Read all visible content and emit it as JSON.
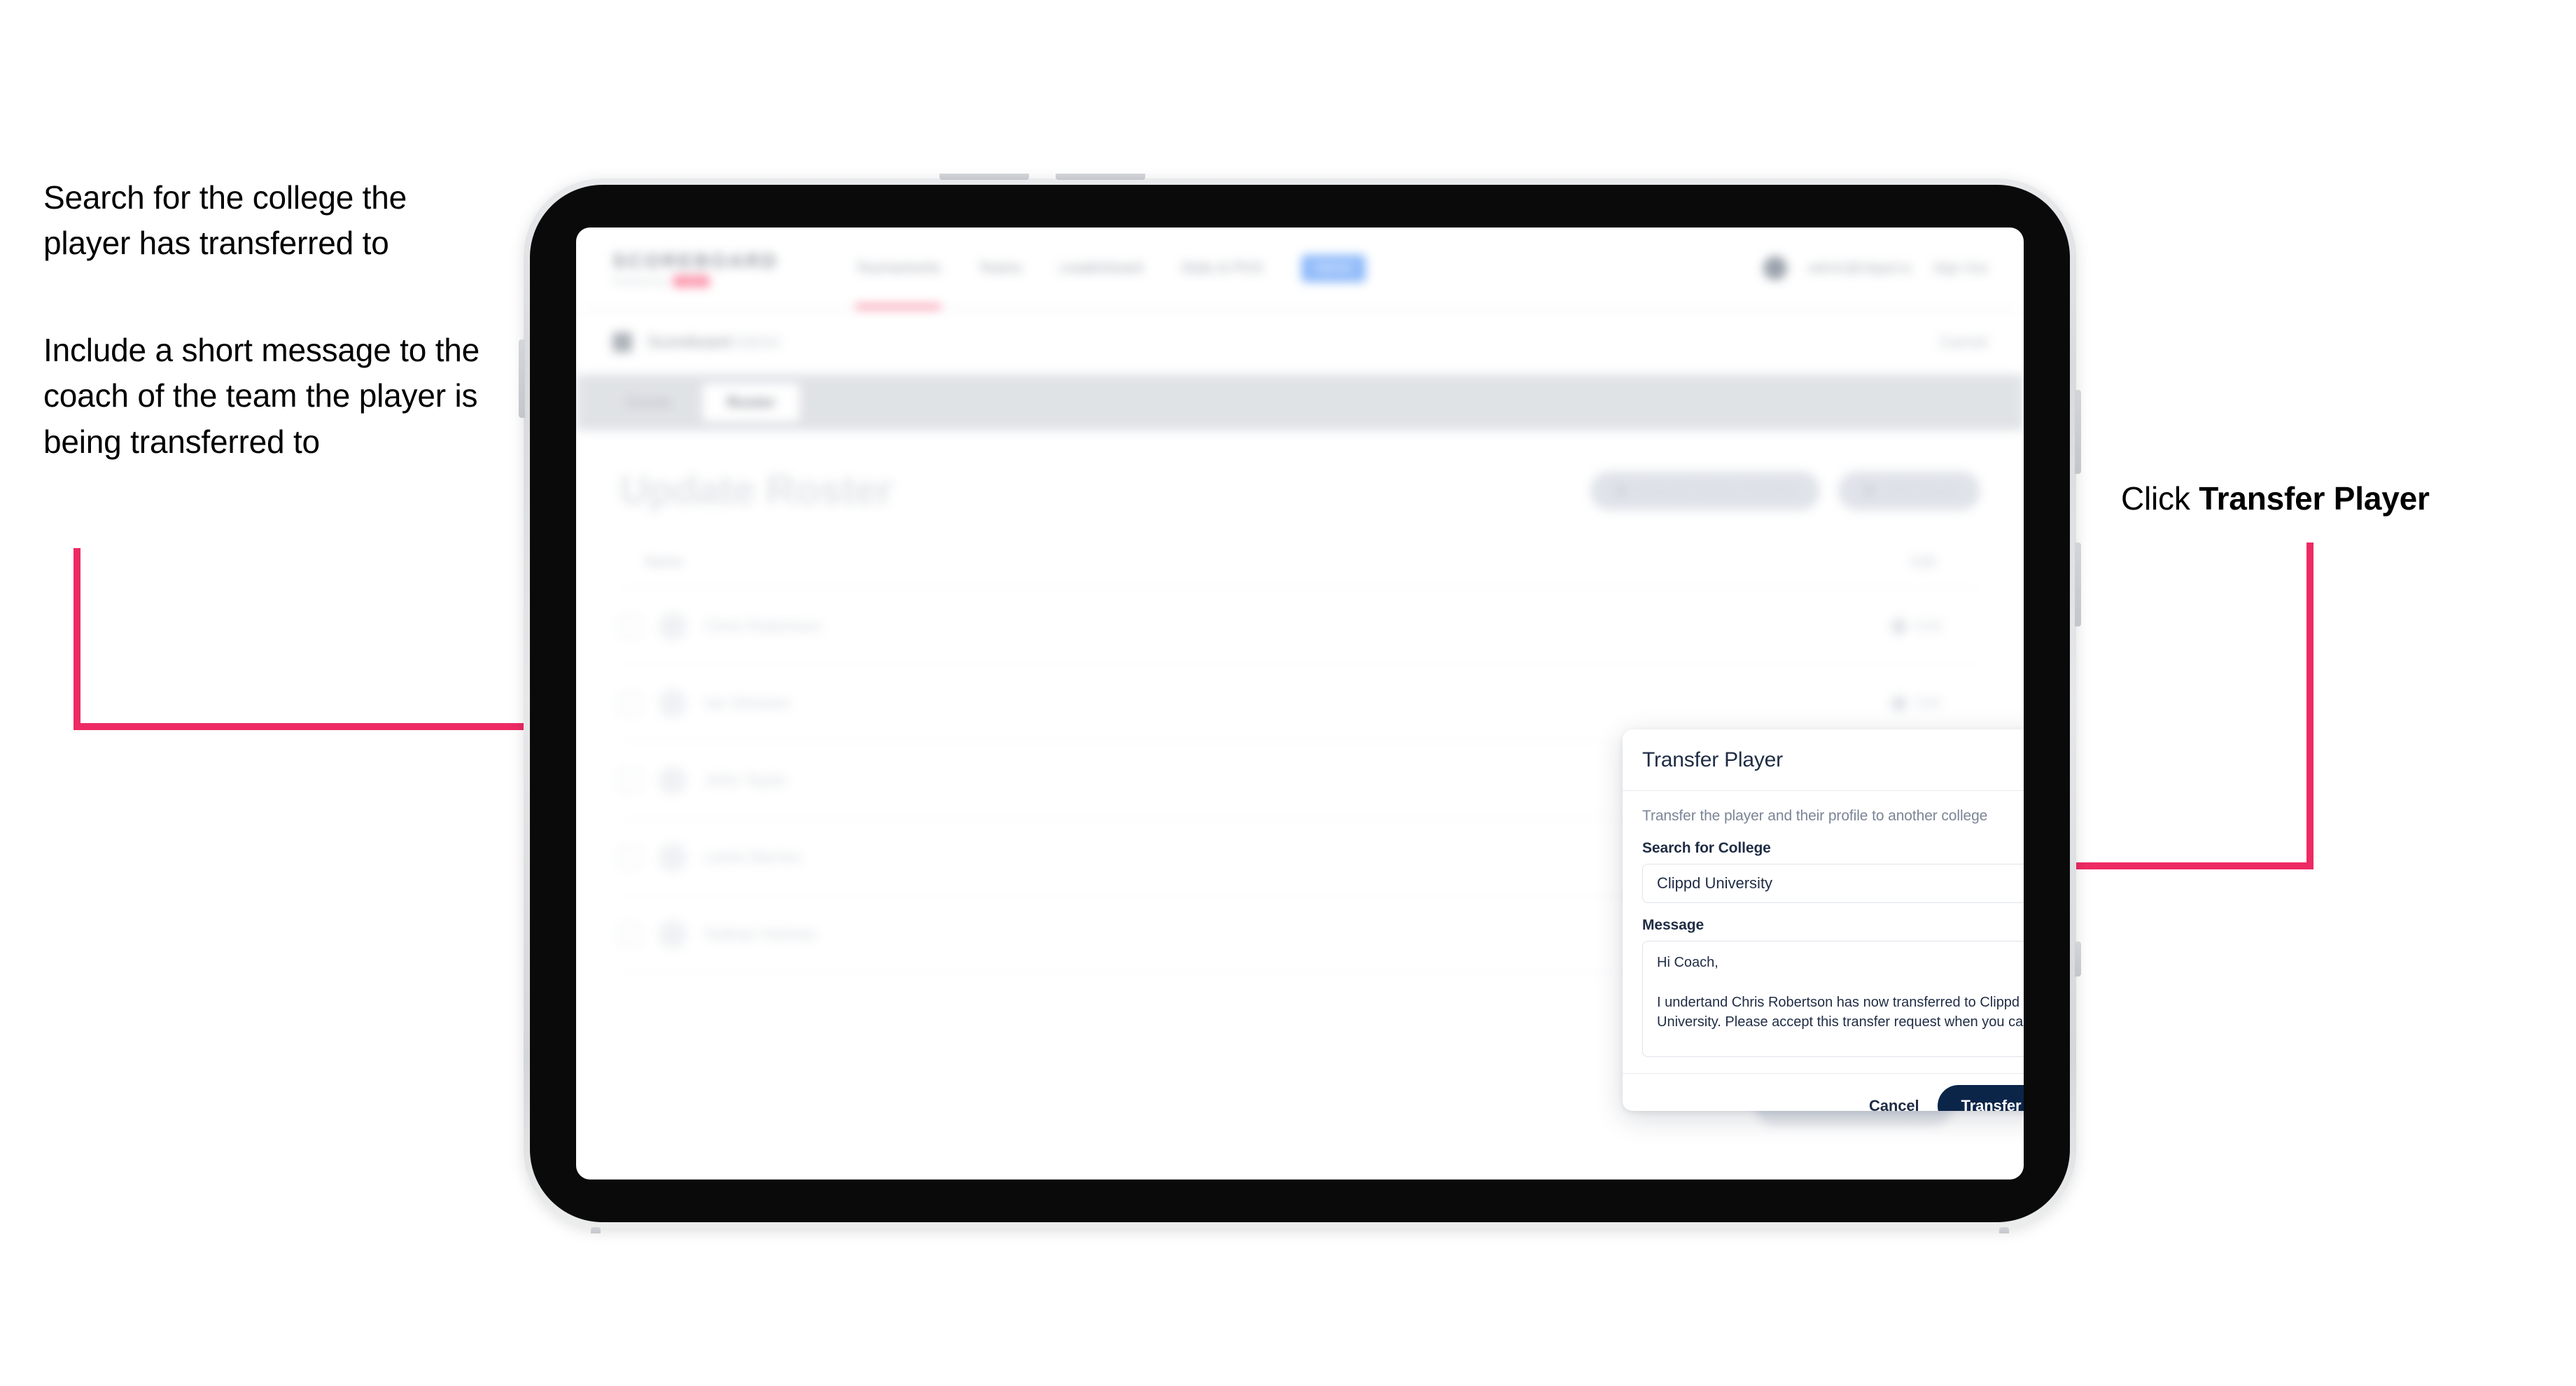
{
  "annotations": {
    "left_note_1": "Search for the college the player has transferred to",
    "left_note_2": "Include a short message to the coach of the team the player is being transferred to",
    "right_note_prefix": "Click ",
    "right_note_emphasis": "Transfer Player"
  },
  "colors": {
    "arrow": "#ED2A63",
    "primary_button": "#0B2549",
    "brand_accent": "#F8345F",
    "nav_pill": "#4A90F7"
  },
  "app": {
    "brand": {
      "name": "SCOREBOARD",
      "subtitle": "Powered by",
      "badge": "clippd"
    },
    "nav_links": [
      "Tournaments",
      "Teams",
      "Leaderboard",
      "Stats & PGS"
    ],
    "nav_pill_label": "Admin",
    "account": {
      "email": "admin@clippd.io",
      "sign_out": "Sign Out"
    },
    "breadcrumb": {
      "text": "Scoreboard",
      "muted": "Admin",
      "right_action": "Cancel"
    },
    "tabs": [
      {
        "label": "Details",
        "active": false
      },
      {
        "label": "Roster",
        "active": true
      }
    ],
    "page_title": "Update Roster",
    "header_buttons": [
      {
        "label": "Request Roster Transfer",
        "icon": "transfer-icon"
      },
      {
        "label": "Add Player",
        "icon": "plus-icon"
      }
    ],
    "roster": {
      "columns": [
        "Name",
        "Edit"
      ],
      "rows": [
        {
          "name": "Chris Robertson",
          "edit_label": "Edit"
        },
        {
          "name": "Ian Winston",
          "edit_label": "Edit"
        },
        {
          "name": "John Taylor",
          "edit_label": "Edit"
        },
        {
          "name": "Lewis Barnes",
          "edit_label": "Edit"
        },
        {
          "name": "Nathan Holmes",
          "edit_label": "Edit"
        }
      ]
    },
    "bottom_action_label": "Save Roster Changes"
  },
  "modal": {
    "title": "Transfer Player",
    "close_icon": "close-icon",
    "description": "Transfer the player and their profile to another college",
    "college_field": {
      "label": "Search for College",
      "value": "Clippd University",
      "placeholder": "Search for College"
    },
    "message_field": {
      "label": "Message",
      "value": "Hi Coach,\n\nI undertand Chris Robertson has now transferred to Clippd University. Please accept this transfer request when you can.",
      "placeholder": "Message"
    },
    "cancel_label": "Cancel",
    "submit_label": "Transfer Player"
  }
}
